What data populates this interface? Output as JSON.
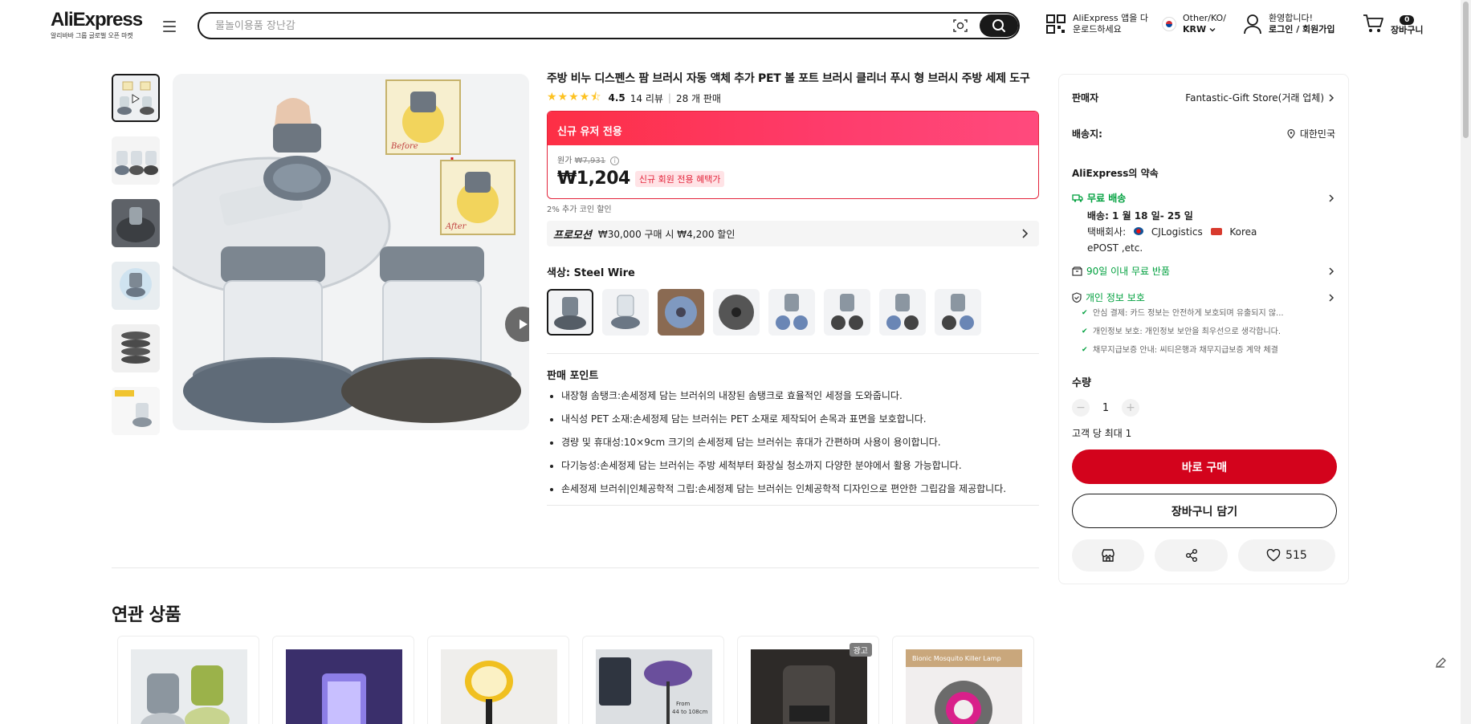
{
  "header": {
    "logo_text": "AliExpress",
    "logo_sub": "알리바바 그룹 글로벌 오픈 마켓",
    "search_placeholder": "물놀이용품 장난감",
    "app_download": [
      "AliExpress 앱을 다",
      "운로드하세요"
    ],
    "locale": "Other/KO/",
    "currency": "KRW",
    "greeting": "환영합니다!",
    "login": "로그인 / 회원가입",
    "cart_count": "0",
    "cart_label": "장바구니"
  },
  "product": {
    "title": "주방 비누 디스펜스 팜 브러시 자동 액체 추가 PET 볼 포트 브러시 클리너 푸시 형 브러시 주방 세제 도구",
    "rating": "4.5",
    "stars": "★★★★⯪",
    "reviews": "14 리뷰",
    "sold": "28 개 판매",
    "promo_header": "신규 유저 전용",
    "original_price_label": "원가",
    "original_price": "₩7,931",
    "price": "₩1,204",
    "price_tag": "신규 회원 전용 혜택가",
    "coin_note": "2% 추가 코인 할인",
    "promotion_label": "프로모션",
    "promotion_text": "₩30,000 구매 시 ₩4,200 할인",
    "color_label": "색상: Steel Wire",
    "image_labels": {
      "before": "Before",
      "after": "After"
    },
    "points_title": "판매 포인트",
    "points": [
      "내장형 솜탱크:손세정제 담는 브러쉬의 내장된 솜탱크로 효율적인 세정을 도와줍니다.",
      "내식성 PET 소재:손세정제 담는 브러쉬는 PET 소재로 제작되어 손목과 표면을 보호합니다.",
      "경량 및 휴대성:10×9cm 크기의 손세정제 담는 브러쉬는 휴대가 간편하며 사용이 용이합니다.",
      "다기능성:손세정제 담는 브러쉬는 주방 세척부터 화장실 청소까지 다양한 분야에서 활용 가능합니다.",
      "손세정제 브러쉬|인체공학적 그립:손세정제 담는 브러쉬는 인체공학적 디자인으로 편안한 그립감을 제공합니다."
    ]
  },
  "sidebar": {
    "seller_label": "판매자",
    "seller_name": "Fantastic-Gift Store(거래 업체)",
    "ship_to_label": "배송지:",
    "ship_to": "대한민국",
    "promise_title": "AliExpress의 약속",
    "free_shipping": "무료 배송",
    "delivery": "배송: 1 월 18 일- 25 일",
    "carrier_label": "택배회사:",
    "carrier_1": "CJLogistics",
    "carrier_2": "Korea",
    "carrier_3": "ePOST ,etc.",
    "free_return": "90일 이내 무료 반품",
    "privacy": "개인 정보 보호",
    "privacy_items": [
      "안심 결제: 카드 정보는 안전하게 보호되며 유출되지 않...",
      "개인정보 보호: 개인정보 보안을 최우선으로 생각합니다.",
      "채무지급보증 안내: 씨티은행과 채무지급보증 계약 체결"
    ],
    "qty_label": "수량",
    "qty_value": "1",
    "qty_limit": "고객 당 최대 1",
    "buy_now": "바로 구매",
    "add_to_cart": "장바구니 담기",
    "wishlist_count": "515"
  },
  "related": {
    "title": "연관 상품",
    "ad_label": "광고",
    "card5_caption": "Bionic Mosquito Killer Lamp",
    "card4_text_1": "From",
    "card4_text_2": "44 to 108cm"
  },
  "colors": {
    "accent_red": "#d3031c",
    "promo_gradient": "#fd2f45",
    "green": "#00a03e",
    "star": "#fdc221"
  }
}
